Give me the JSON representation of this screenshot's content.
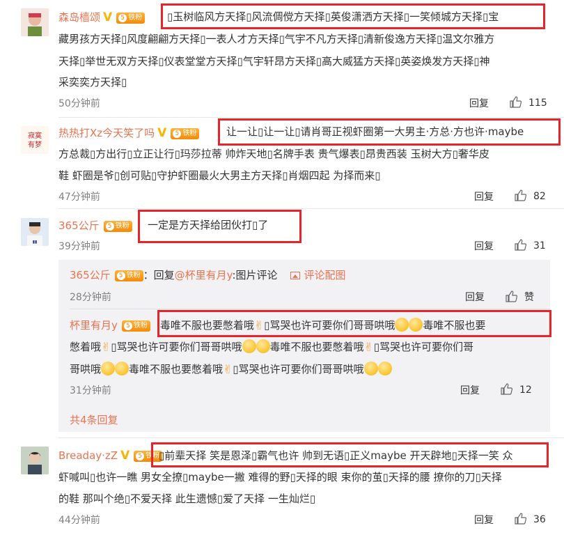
{
  "comments": [
    {
      "username": "森岛樯颂",
      "fan_level": "5",
      "fan_label": "铁粉",
      "lines": [
        "▯玉树临风方天择▯风流倜傥方天择▯英俊潇洒方天择▯一笑倾城方天择▯宝",
        "藏男孩方天择▯风度翩翩方天择▯一表人才方天择▯气宇不凡方天择▯清新俊逸方天择▯温文尔雅方",
        "天择▯举世无双方天择▯仪表堂堂方天择▯气宇轩昂方天择▯高大威猛方天择▯英姿焕发方天择▯神",
        "采奕奕方天择▯"
      ],
      "time": "50分钟前",
      "reply_label": "回复",
      "likes": "115"
    },
    {
      "username": "热热打Xz今天笑了吗",
      "fan_level": "5",
      "fan_label": "铁粉",
      "lines": [
        "让一让▯让一让▯请肖哥正视虾圈第一大男主·方总·方也许·maybe",
        "方总裁▯方出行▯立正让行▯玛莎拉蒂 帅炸天地▯名牌手表 贵气爆表▯昂贵西装 玉树大方▯奢华皮",
        "鞋 虾圈是爷▯创可贴▯守护虾圈最火大男主方天择▯肖烟四起 为择而来▯"
      ],
      "time": "47分钟前",
      "reply_label": "回复",
      "likes": "82"
    },
    {
      "username": "365公斤",
      "fan_level": "5",
      "fan_label": "铁粉",
      "lines": [
        "一定是方天择给团伙打▯了"
      ],
      "time": "39分钟前",
      "reply_label": "回复",
      "likes": "31"
    }
  ],
  "replies": [
    {
      "username": "365公斤",
      "fan_level": "5",
      "fan_label": "铁粉",
      "prefix": "：回复",
      "mention": "@杯里有月y",
      "suffix": ":图片评论",
      "pic_link": "评论配图",
      "time": "28分钟前",
      "reply_label": "回复",
      "likes": "赞"
    },
    {
      "username": "杯里有月y",
      "fan_level": "5",
      "fan_label": "铁粉",
      "line1_a": "毒唯不服也要憋着哦",
      "line1_b": "▯骂哭也许可要你们哥哥哄哦",
      "line1_c": "毒唯不服也要",
      "line2_a": "憋着哦",
      "line2_b": "▯骂哭也许可要你们哥哥哄哦",
      "line2_c": "毒唯不服也要憋着哦",
      "line2_d": "▯骂哭也许可要你们哥",
      "line3_a": "哥哄哦",
      "line3_b": "毒唯不服也要憋着哦",
      "line3_c": "▯骂哭也许可要你们哥哥哄哦",
      "time": "31分钟前",
      "reply_label": "回复",
      "likes": "12"
    }
  ],
  "more_replies": "共4条回复",
  "last_comment": {
    "username": "Breaday·zZ",
    "fan_level": "5",
    "fan_label": "铁粉",
    "lines": [
      "▯前辈天择 笑是恩泽▯霸气也许 帅到无语▯正义maybe 开天辟地▯天择一笑 众",
      "虾喊叫▯也许一瞧 男女全撩▯maybe一撇 难得的野▯天择的眼 束你的茧▯天择的腰 撩你的刀▯天择",
      "的鞋 那叫个绝▯不爱天择 此生遗憾▯爱了天择 一生灿烂▯"
    ],
    "time": "44分钟前",
    "reply_label": "回复",
    "likes": "36"
  },
  "colors": {
    "accent": "#eb7350",
    "highlight_box": "#e8232a",
    "reply_bg": "#f2f2f5"
  },
  "icons": {
    "like": "thumbs-up-icon",
    "verified": "gold-v-icon",
    "fan": "fan-badge-icon",
    "picture": "picture-icon",
    "emoji": "emoji-icon",
    "hand": "peace-hand-icon"
  }
}
